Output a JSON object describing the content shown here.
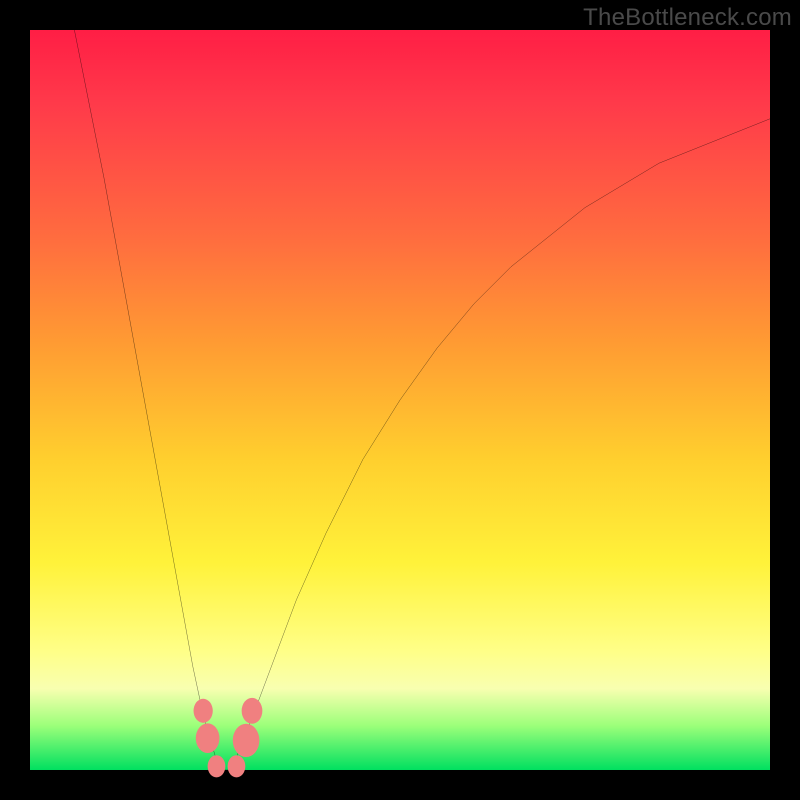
{
  "attribution": "TheBottleneck.com",
  "chart_data": {
    "type": "line",
    "title": "",
    "xlabel": "",
    "ylabel": "",
    "xlim": [
      0,
      100
    ],
    "ylim": [
      0,
      100
    ],
    "background_gradient": {
      "top_color": "#ff1e45",
      "bottom_color": "#00e060",
      "meaning": "bottleneck severity (red=high, green=none)"
    },
    "series": [
      {
        "name": "bottleneck-curve",
        "comment": "V-shaped curve; minimum ≈ x=26, y≈0. Values are percent of plot height from bottom (0) to top (100).",
        "x": [
          6,
          8,
          10,
          12,
          14,
          16,
          18,
          20,
          22,
          23.5,
          25,
          26,
          27,
          28,
          30,
          33,
          36,
          40,
          45,
          50,
          55,
          60,
          65,
          70,
          75,
          80,
          85,
          90,
          95,
          100
        ],
        "y": [
          100,
          90,
          80,
          69,
          58,
          47,
          36,
          25,
          14,
          7,
          2,
          0,
          0,
          2,
          7,
          15,
          23,
          32,
          42,
          50,
          57,
          63,
          68,
          72,
          76,
          79,
          82,
          84,
          86,
          88
        ]
      }
    ],
    "markers": [
      {
        "name": "marker-left-upper",
        "x": 23.4,
        "y": 8.0,
        "r": 1.3,
        "color": "#f08080"
      },
      {
        "name": "marker-left-lower",
        "x": 24.0,
        "y": 4.3,
        "r": 1.6,
        "color": "#f08080"
      },
      {
        "name": "marker-bottom-1",
        "x": 25.2,
        "y": 0.5,
        "r": 1.2,
        "color": "#f08080"
      },
      {
        "name": "marker-bottom-2",
        "x": 27.9,
        "y": 0.5,
        "r": 1.2,
        "color": "#f08080"
      },
      {
        "name": "marker-right-lower",
        "x": 29.2,
        "y": 4.0,
        "r": 1.8,
        "color": "#f08080"
      },
      {
        "name": "marker-right-upper",
        "x": 30.0,
        "y": 8.0,
        "r": 1.4,
        "color": "#f08080"
      }
    ]
  }
}
